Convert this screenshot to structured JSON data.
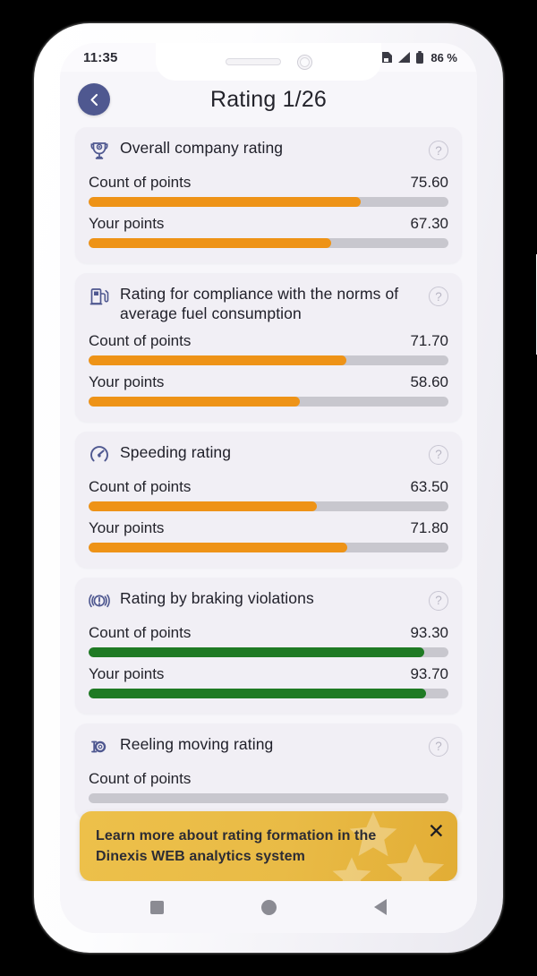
{
  "status_bar": {
    "time": "11:35",
    "battery": "86 %",
    "icons": [
      "sim-card-icon",
      "signal-icon",
      "battery-icon"
    ]
  },
  "header": {
    "title": "Rating 1/26",
    "back_icon": "chevron-left-icon",
    "back_color": "#4f5890"
  },
  "labels": {
    "count_of_points": "Count of points",
    "your_points": "Your points",
    "help": "?"
  },
  "colors": {
    "orange": "#ee9317",
    "green": "#1f7a24",
    "track": "#c8c7ce",
    "card_bg": "#f1eff5",
    "screen_bg": "#f7f6fa",
    "banner": "#e9bb46"
  },
  "cards": [
    {
      "title": "Overall company rating",
      "icon": "trophy-icon",
      "count_value": "75.60",
      "count_percent": 75.6,
      "your_value": "67.30",
      "your_percent": 67.3,
      "bar_color": "#ee9317"
    },
    {
      "title": "Rating for compliance with the norms of average fuel consumption",
      "icon": "fuel-pump-icon",
      "count_value": "71.70",
      "count_percent": 71.7,
      "your_value": "58.60",
      "your_percent": 58.6,
      "bar_color": "#ee9317"
    },
    {
      "title": "Speeding rating",
      "icon": "speedometer-icon",
      "count_value": "63.50",
      "count_percent": 63.5,
      "your_value": "71.80",
      "your_percent": 71.8,
      "bar_color": "#ee9317"
    },
    {
      "title": "Rating by braking violations",
      "icon": "brake-warning-icon",
      "count_value": "93.30",
      "count_percent": 93.3,
      "your_value": "93.70",
      "your_percent": 93.7,
      "bar_color": "#1f7a24"
    },
    {
      "title": "Reeling moving rating",
      "icon": "reel-icon",
      "count_value": "",
      "count_percent": 0,
      "your_value": "",
      "your_percent": 0,
      "bar_color": "#ee9317"
    }
  ],
  "banner": {
    "text": "Learn more about rating formation in the Dinexis WEB analytics system",
    "close_icon": "close-icon"
  },
  "nav_bar": {
    "recents": "recents-button",
    "home": "home-button",
    "back": "back-button"
  }
}
